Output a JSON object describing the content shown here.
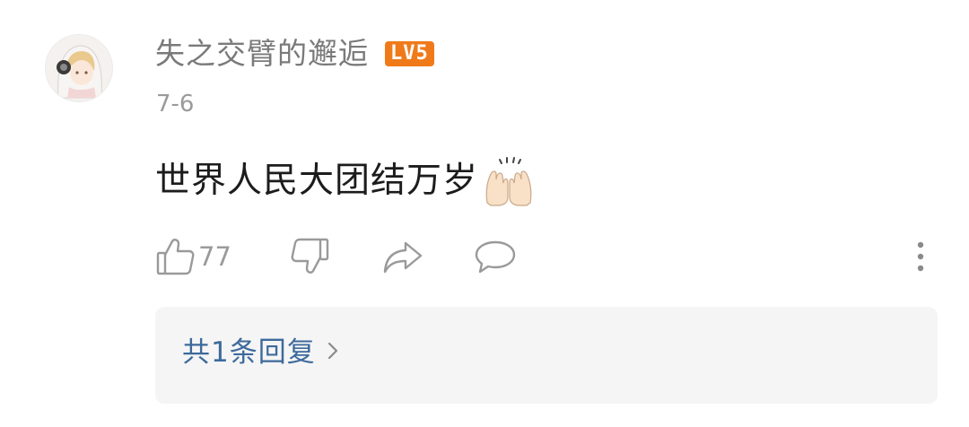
{
  "comment": {
    "username": "失之交臂的邂逅",
    "level_badge": "LV5",
    "date": "7-6",
    "content": "世界人民大团结万岁",
    "content_emoji": "raising-hands-emoji",
    "actions": {
      "like_icon": "thumbs-up-icon",
      "like_count": "77",
      "dislike_icon": "thumbs-down-icon",
      "share_icon": "share-arrow-icon",
      "reply_icon": "speech-bubble-icon",
      "more_icon": "vertical-dots-icon"
    },
    "replies": {
      "label": "共1条回复",
      "chevron_icon": "chevron-right-icon"
    }
  },
  "colors": {
    "username": "#7a7a7a",
    "badge": "#f07a1a",
    "date": "#9a9a9a",
    "content": "#1c1c1c",
    "icon": "#9a9a9a",
    "link": "#3d6a9c",
    "replies_bg": "#f5f5f5"
  }
}
